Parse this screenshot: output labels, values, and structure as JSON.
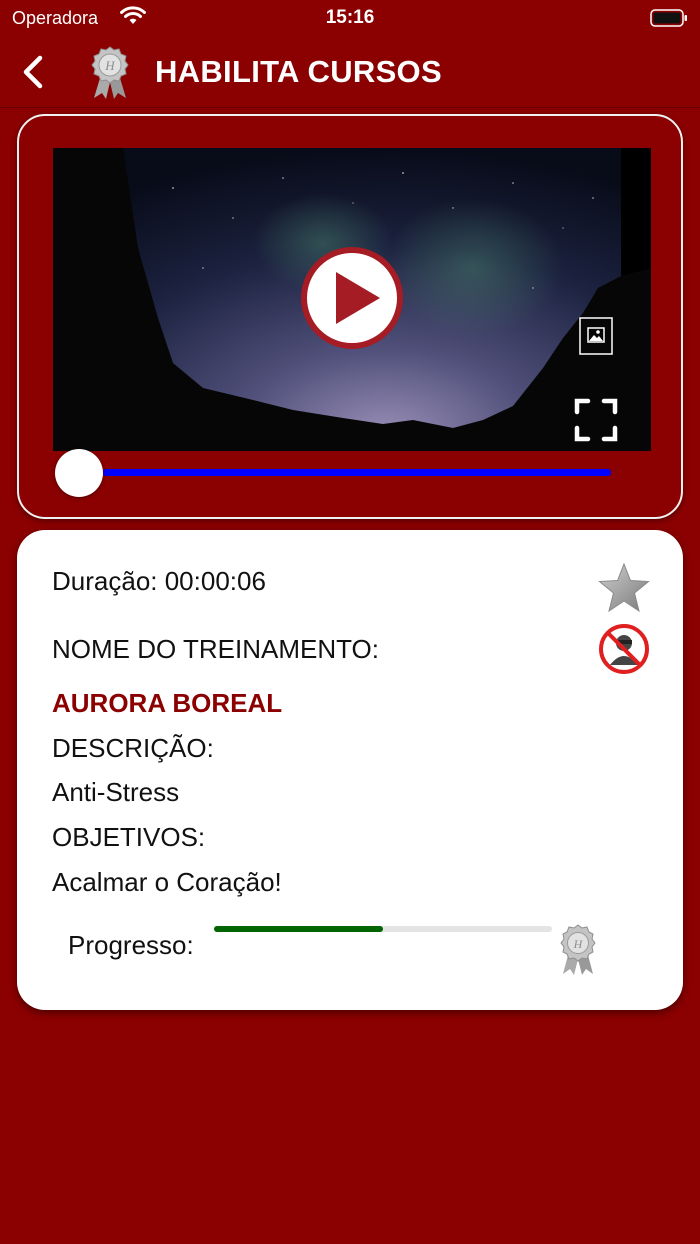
{
  "status_bar": {
    "carrier": "Operadora",
    "time": "15:16"
  },
  "nav": {
    "title": "HABILITA CURSOS",
    "back_icon": "chevron-left-icon",
    "logo_icon": "award-badge-icon"
  },
  "video": {
    "play_icon": "play-icon",
    "pip_icon": "picture-in-picture-icon",
    "fullscreen_icon": "fullscreen-icon",
    "playback_position": 0
  },
  "info": {
    "duration_label": "Duração: 00:00:06",
    "name_label": "NOME DO TREINAMENTO:",
    "course_name": "AURORA BOREAL",
    "description_label": "DESCRIÇÃO:",
    "description": "Anti-Stress",
    "objectives_label": "OBJETIVOS:",
    "objectives": "Acalmar o Coração!",
    "progress_label": "Progresso:",
    "progress_fraction": 0.5,
    "favorite_icon": "star-icon",
    "no-person_icon": "no-person-icon",
    "badge_icon": "award-badge-icon"
  },
  "colors": {
    "background": "#8b0000",
    "accent": "#8b0000",
    "seek_bar": "#0000ff",
    "progress": "#006400",
    "card": "#ffffff"
  }
}
